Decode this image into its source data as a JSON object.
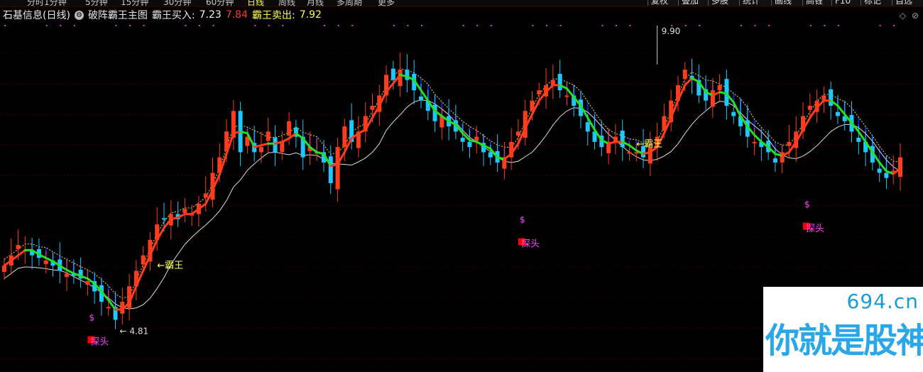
{
  "toolbar": {
    "periods": [
      {
        "label": "分时",
        "active": false
      },
      {
        "label": "1分钟",
        "active": false
      },
      {
        "label": "5分钟",
        "active": false
      },
      {
        "label": "15分钟",
        "active": false
      },
      {
        "label": "30分钟",
        "active": false
      },
      {
        "label": "60分钟",
        "active": false
      },
      {
        "label": "日线",
        "active": true
      },
      {
        "label": "周线",
        "active": false
      },
      {
        "label": "月线",
        "active": false
      },
      {
        "label": "多周期",
        "active": false
      },
      {
        "label": "更多",
        "active": false
      }
    ],
    "right_buttons": [
      "复权",
      "叠加",
      "多股",
      "统计",
      "画线",
      "F10",
      "标记",
      "自选"
    ],
    "right_buttons_partial": [
      "高锂"
    ]
  },
  "legend": {
    "stock_name": "石基信息(日线)",
    "indicator_icon": "gear-circle-icon",
    "indicator_name": "破阵霸王主图",
    "buy_label": "霸王买入:",
    "buy_value": "7.23",
    "buy_value2": "7.84",
    "sell_label": "霸王卖出:",
    "sell_value": "7.92"
  },
  "colors": {
    "up": "#ff3c1e",
    "down": "#1ec8ff",
    "buy_line_up": "#ff3c1e",
    "buy_line_down": "#22e022",
    "slow_line": "#dcdcdc",
    "resist_line": "#e6e64a",
    "fill": "#1a2ad0",
    "signal_text": "#ff44ff",
    "signal_box": "#ff0000",
    "annotation": "#ffff54",
    "dots": "#dd33dd"
  },
  "annotations": {
    "high_label": "9.90",
    "low_label": "4.81",
    "bawang": "←霸王",
    "tantou": "探头",
    "dollar": "$"
  },
  "watermark": {
    "url": "694.cn",
    "text": "你就是股神"
  },
  "chart_data": {
    "type": "candlestick",
    "title": "破阵霸王主图",
    "price_range": [
      4.2,
      10.6
    ],
    "series": [
      {
        "name": "K线",
        "count": 130
      },
      {
        "name": "霸王买入",
        "values_last": [
          7.23,
          7.84
        ]
      },
      {
        "name": "霸王卖出",
        "values_last": [
          7.92
        ]
      }
    ],
    "key_points": [
      {
        "x_index": 16,
        "label": "4.81",
        "type": "low"
      },
      {
        "x_index": 94,
        "label": "9.90",
        "type": "high"
      }
    ],
    "close_series": [
      6.0,
      6.2,
      6.4,
      6.3,
      6.2,
      6.15,
      6.1,
      6.0,
      5.9,
      5.85,
      5.8,
      5.75,
      5.7,
      5.5,
      5.3,
      5.2,
      4.95,
      5.3,
      5.6,
      5.9,
      6.2,
      6.5,
      6.8,
      6.9,
      7.0,
      6.9,
      7.1,
      7.0,
      7.2,
      7.4,
      7.8,
      8.1,
      8.6,
      9.0,
      8.2,
      8.5,
      8.2,
      8.3,
      8.6,
      8.2,
      8.4,
      8.8,
      8.5,
      8.1,
      8.3,
      8.2,
      8.0,
      7.6,
      8.3,
      8.7,
      8.4,
      8.6,
      8.9,
      9.1,
      9.3,
      9.7,
      9.6,
      9.8,
      9.6,
      9.4,
      9.2,
      9.0,
      8.8,
      8.9,
      8.7,
      8.6,
      8.4,
      8.3,
      8.5,
      8.2,
      8.1,
      8.0,
      8.1,
      8.4,
      8.6,
      9.0,
      9.2,
      9.4,
      9.5,
      9.6,
      9.4,
      9.3,
      9.1,
      8.9,
      8.6,
      8.4,
      8.3,
      8.4,
      8.5,
      8.3,
      8.2,
      8.2,
      8.1,
      8.3,
      8.5,
      8.9,
      9.2,
      9.5,
      9.8,
      9.6,
      9.3,
      9.2,
      9.4,
      9.5,
      9.1,
      8.9,
      8.7,
      8.5,
      8.4,
      8.3,
      8.2,
      8.0,
      8.2,
      8.4,
      8.6,
      8.9,
      9.1,
      9.2,
      9.3,
      9.1,
      8.9,
      8.8,
      8.6,
      8.4,
      8.2,
      8.0,
      7.8,
      7.7,
      7.84,
      8.1
    ],
    "dots_top": true
  }
}
